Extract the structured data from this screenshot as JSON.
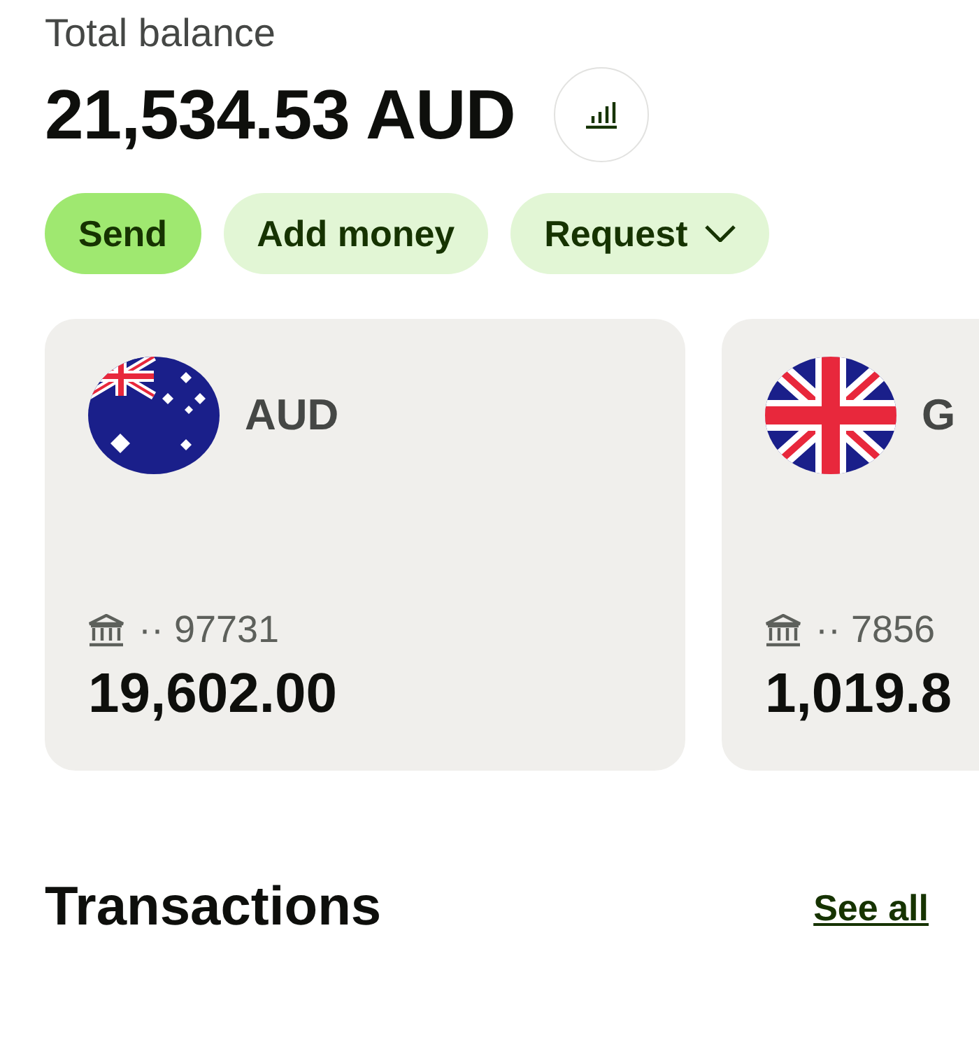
{
  "balance": {
    "label": "Total balance",
    "amount": "21,534.53 AUD"
  },
  "actions": [
    {
      "label": "Send",
      "kind": "primary"
    },
    {
      "label": "Add money",
      "kind": "secondary"
    },
    {
      "label": "Request",
      "kind": "dropdown"
    }
  ],
  "accounts": [
    {
      "currency": "AUD",
      "kind": "au",
      "account": "·· 97731",
      "balance": "19,602.00"
    },
    {
      "currency": "G",
      "kind": "gb",
      "account": "·· 7856",
      "balance": "1,019.8"
    }
  ],
  "transactions": {
    "title": "Transactions",
    "link": "See all"
  }
}
